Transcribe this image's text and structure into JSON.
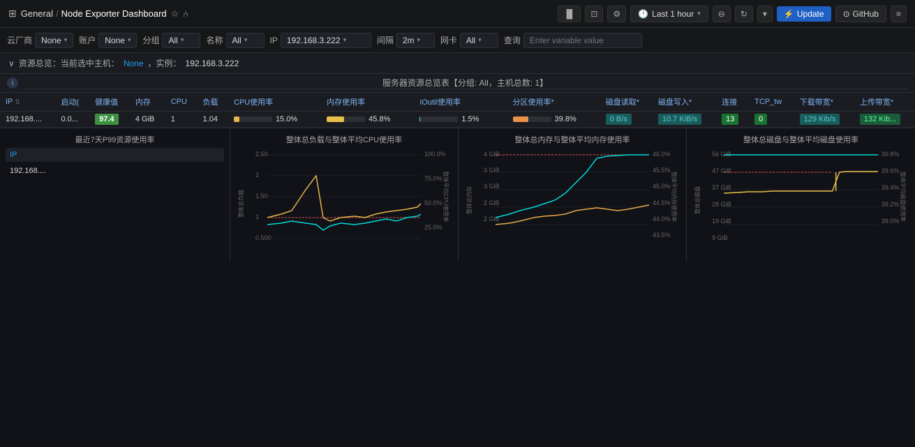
{
  "topNav": {
    "gridIcon": "⊞",
    "breadcrumb": {
      "prefix": "General",
      "separator": "/",
      "current": "Node Exporter Dashboard"
    },
    "starIcon": "★",
    "shareIcon": "⎘",
    "icons": [
      "bar-chart",
      "camera",
      "gear"
    ],
    "timeRange": {
      "icon": "🕐",
      "label": "Last 1 hour",
      "chevron": "▾"
    },
    "zoomOutIcon": "⊖",
    "refreshIcon": "↻",
    "moreIcon": "▾",
    "menuIcon": "≡",
    "updateBtn": "⚡ Update",
    "githubBtn": "⊙ GitHub"
  },
  "varRow": {
    "items": [
      {
        "label": "云厂商",
        "value": "None",
        "id": "vendor"
      },
      {
        "label": "账户",
        "value": "None",
        "id": "account"
      },
      {
        "label": "分组",
        "value": "All",
        "id": "group"
      },
      {
        "label": "名称",
        "value": "All",
        "id": "name"
      },
      {
        "label": "IP",
        "value": "192.168.3.222",
        "id": "ip",
        "wide": true
      },
      {
        "label": "间隔",
        "value": "2m",
        "id": "interval"
      },
      {
        "label": "网卡",
        "value": "All",
        "id": "nic"
      },
      {
        "label": "查询",
        "placeholder": "Enter variable value",
        "id": "query",
        "isInput": true
      }
    ]
  },
  "resourceHeader": {
    "arrowIcon": "∨",
    "text": "资源总览：当前选中主机：",
    "host1": "None",
    "separator": "，实例：",
    "host2": "192.168.3.222"
  },
  "tableSection": {
    "infoIcon": "i",
    "title": "服务器资源总览表【分组: All，主机总数: 1】",
    "columns": [
      {
        "label": "IP",
        "sortable": true
      },
      {
        "label": "启动(",
        "sortable": false
      },
      {
        "label": "健康值",
        "sortable": false
      },
      {
        "label": "内存",
        "sortable": false
      },
      {
        "label": "CPU",
        "sortable": false
      },
      {
        "label": "负载",
        "sortable": false
      },
      {
        "label": "CPU使用率",
        "sortable": false
      },
      {
        "label": "内存使用率",
        "sortable": false
      },
      {
        "label": "IOutil使用率",
        "sortable": false
      },
      {
        "label": "分区使用率*",
        "sortable": false
      },
      {
        "label": "磁盘读取*",
        "sortable": false
      },
      {
        "label": "磁盘写入*",
        "sortable": false
      },
      {
        "label": "连接",
        "sortable": false
      },
      {
        "label": "TCP_tw",
        "sortable": false
      },
      {
        "label": "下载带宽*",
        "sortable": false
      },
      {
        "label": "上传带宽*",
        "sortable": false
      }
    ],
    "rows": [
      {
        "ip": "192.168....",
        "uptime": "0.0...",
        "health": "97.4",
        "memory": "4 GiB",
        "cpu": "1",
        "load": "1.04",
        "cpuUsage": {
          "value": 15.0,
          "text": "15.0%"
        },
        "memUsage": {
          "value": 45.8,
          "text": "45.8%"
        },
        "ioutilUsage": {
          "value": 1.5,
          "text": "1.5%"
        },
        "partUsage": {
          "value": 39.8,
          "text": "39.8%"
        },
        "diskRead": "0 B/s",
        "diskWrite": "10.7 KiB/s",
        "connections": "13",
        "tcpTw": "0",
        "download": "129 Kib/s",
        "upload": "132 Kib..."
      }
    ]
  },
  "charts": {
    "leftPanel": {
      "title": "最近7天P99资源使用率",
      "columnHeader": "IP",
      "rows": [
        "192.168...."
      ]
    },
    "chart1": {
      "title": "整体总负载与整体平均CPU使用率",
      "yAxisLeft": [
        "2.50",
        "2",
        "1.50",
        "1",
        "0.500"
      ],
      "yAxisRight": [
        "100.0%",
        "75.0%",
        "50.0%",
        "25.0%"
      ],
      "yLabelLeft": "整体总负载",
      "yLabelRight": "整体平均CPU使用率"
    },
    "chart2": {
      "title": "整体总内存与整体平均内存使用率",
      "yAxisLeft": [
        "4 GiB",
        "3 GiB",
        "3 GiB",
        "2 GiB",
        "2 GiB"
      ],
      "yAxisRight": [
        "46.0%",
        "45.5%",
        "45.0%",
        "44.5%",
        "44.0%",
        "43.5%"
      ],
      "yLabelLeft": "整体总内存",
      "yLabelRight": "整体平均内存使用率"
    },
    "chart3": {
      "title": "整体总磁盘与整体平均磁盘使用率",
      "yAxisLeft": [
        "56 GiB",
        "47 GiB",
        "37 GiB",
        "28 GiB",
        "19 GiB",
        "9 GiB"
      ],
      "yAxisRight": [
        "39.8%",
        "39.6%",
        "39.4%",
        "39.2%",
        "39.0%"
      ],
      "yLabelLeft": "整体总磁盘",
      "yLabelRight": "整体平均磁盘使用率"
    }
  }
}
